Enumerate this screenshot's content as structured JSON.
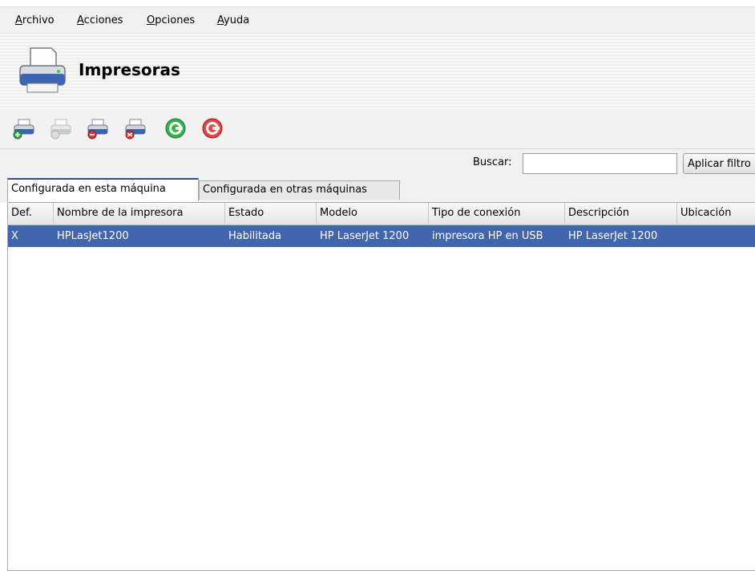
{
  "menu": [
    {
      "mnemonic": "A",
      "rest": "rchivo"
    },
    {
      "mnemonic": "A",
      "rest": "cciones"
    },
    {
      "mnemonic": "O",
      "rest": "pciones"
    },
    {
      "mnemonic": "A",
      "rest": "yuda"
    }
  ],
  "header": {
    "title": "Impresoras",
    "icon": "printer-icon"
  },
  "toolbar": {
    "buttons": [
      {
        "name": "add-printer",
        "icon": "printer-add-icon",
        "enabled": true
      },
      {
        "name": "set-default",
        "icon": "printer-default-icon",
        "enabled": false
      },
      {
        "name": "delete-printer",
        "icon": "printer-delete-icon",
        "enabled": true
      },
      {
        "name": "edit-printer",
        "icon": "printer-edit-icon",
        "enabled": true
      },
      {
        "name": "refresh",
        "icon": "refresh-icon",
        "enabled": true
      },
      {
        "name": "restart-cups",
        "icon": "restart-icon",
        "enabled": true
      }
    ]
  },
  "search": {
    "label": "Buscar:",
    "value": "",
    "apply_label": "Aplicar filtro"
  },
  "tabs": [
    {
      "label": "Configurada en esta máquina",
      "active": true
    },
    {
      "label": "Configurada en otras máquinas",
      "active": false
    }
  ],
  "table": {
    "columns": [
      "Def.",
      "Nombre de la impresora",
      "Estado",
      "Modelo",
      "Tipo de conexión",
      "Descripción",
      "Ubicación"
    ],
    "rows": [
      [
        "X",
        "HPLasJet1200",
        "Habilitada",
        "HP LaserJet 1200",
        "impresora HP en USB",
        "HP LaserJet 1200",
        ""
      ]
    ],
    "selected_row": 0
  },
  "colors": {
    "selection": "#4266ae",
    "tab_accent": "#2b4f8e"
  }
}
